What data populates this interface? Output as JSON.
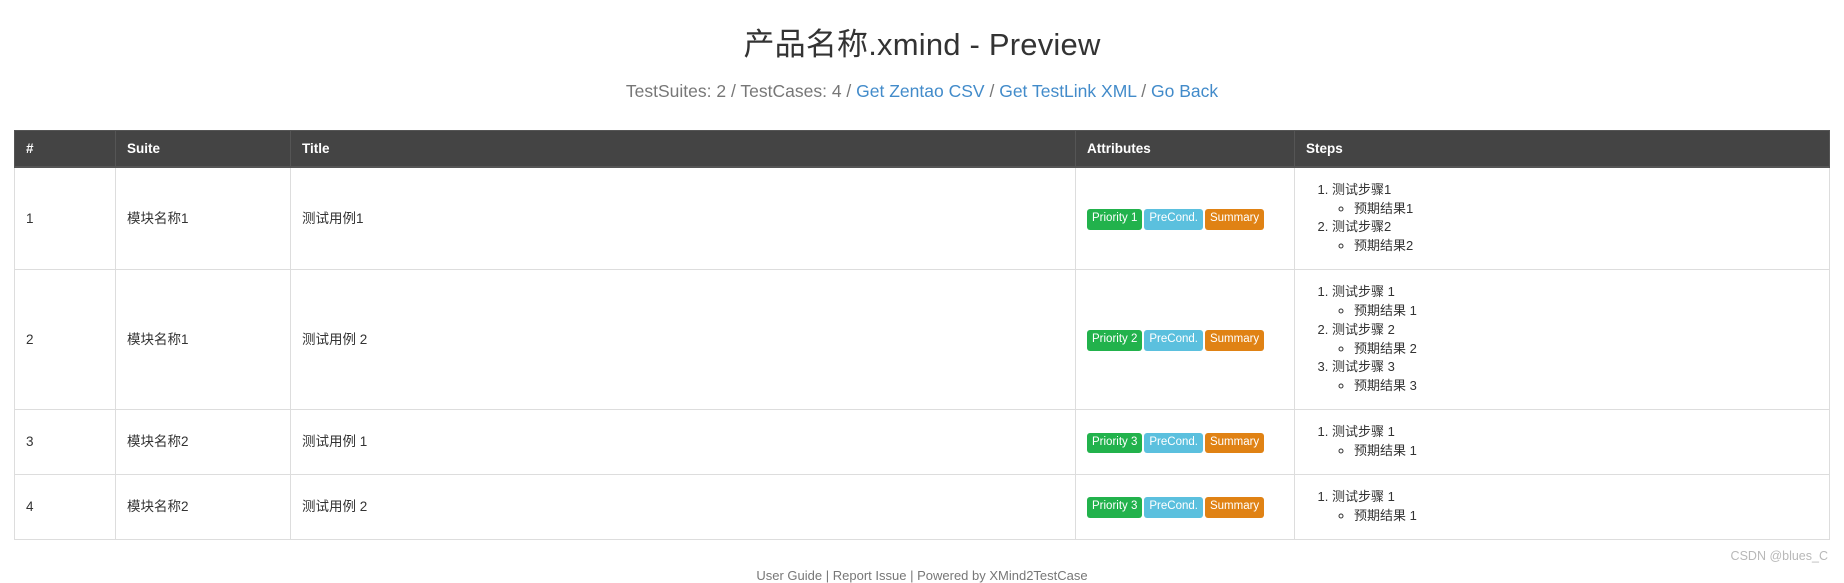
{
  "header": {
    "title": "产品名称.xmind - Preview",
    "subtitle": {
      "suites_label": "TestSuites: 2",
      "cases_label": "TestCases: 4",
      "zentao_link": "Get Zentao CSV",
      "testlink_link": "Get TestLink XML",
      "back_link": "Go Back",
      "separator": "/"
    }
  },
  "table": {
    "columns": {
      "index": "#",
      "suite": "Suite",
      "title": "Title",
      "attributes": "Attributes",
      "steps": "Steps"
    },
    "rows": [
      {
        "index": "1",
        "suite": "模块名称1",
        "title": "测试用例1",
        "badges": {
          "priority": "Priority 1",
          "precond": "PreCond.",
          "summary": "Summary"
        },
        "steps": [
          {
            "step": "测试步骤1",
            "result": "预期结果1"
          },
          {
            "step": "测试步骤2",
            "result": "预期结果2"
          }
        ]
      },
      {
        "index": "2",
        "suite": "模块名称1",
        "title": "测试用例 2",
        "badges": {
          "priority": "Priority 2",
          "precond": "PreCond.",
          "summary": "Summary"
        },
        "steps": [
          {
            "step": "测试步骤 1",
            "result": "预期结果 1"
          },
          {
            "step": "测试步骤 2",
            "result": "预期结果 2"
          },
          {
            "step": "测试步骤 3",
            "result": "预期结果 3"
          }
        ]
      },
      {
        "index": "3",
        "suite": "模块名称2",
        "title": "测试用例 1",
        "badges": {
          "priority": "Priority 3",
          "precond": "PreCond.",
          "summary": "Summary"
        },
        "steps": [
          {
            "step": "测试步骤 1",
            "result": "预期结果 1"
          }
        ]
      },
      {
        "index": "4",
        "suite": "模块名称2",
        "title": "测试用例 2",
        "badges": {
          "priority": "Priority 3",
          "precond": "PreCond.",
          "summary": "Summary"
        },
        "steps": [
          {
            "step": "测试步骤 1",
            "result": "预期结果 1"
          }
        ]
      }
    ]
  },
  "footer": {
    "user_guide": "User Guide",
    "report_issue": "Report Issue",
    "powered_by": "Powered by XMind2TestCase",
    "divider": "|"
  },
  "watermark": "CSDN @blues_C",
  "colors": {
    "header_bg": "#444444",
    "link": "#428bca",
    "priority_badge": "#22b24c",
    "precond_badge": "#5bc0de",
    "summary_badge": "#e08214",
    "muted_text": "#777777"
  }
}
